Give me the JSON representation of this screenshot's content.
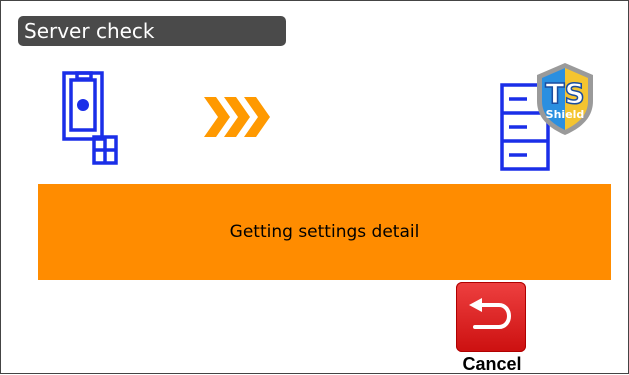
{
  "window": {
    "title": "Server check"
  },
  "progress": {
    "source_icon": "survey-instrument-icon",
    "direction_icon": "triple-chevron-right-icon",
    "target_icon": "server-icon",
    "target_badge": {
      "icon": "shield-icon",
      "logo_text": "TS",
      "logo_subtext": "Shield"
    }
  },
  "status": {
    "message": "Getting settings detail"
  },
  "actions": {
    "cancel_label": "Cancel",
    "cancel_icon": "return-arrow-icon"
  },
  "colors": {
    "title_bar": "#4a4a4a",
    "banner": "#ff8c00",
    "icon_blue": "#1a2ee8",
    "cancel_red": "#dd2222"
  }
}
